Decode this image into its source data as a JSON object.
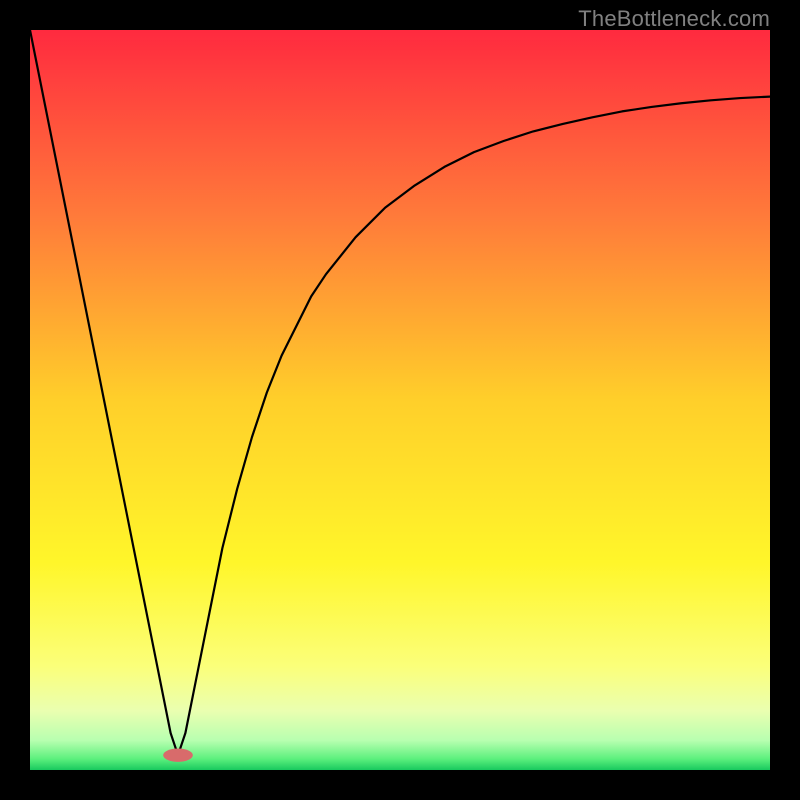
{
  "watermark": "TheBottleneck.com",
  "chart_data": {
    "type": "line",
    "title": "",
    "xlabel": "",
    "ylabel": "",
    "xlim": [
      0,
      100
    ],
    "ylim": [
      0,
      100
    ],
    "series": [
      {
        "name": "curve",
        "x": [
          0,
          2,
          4,
          6,
          8,
          10,
          12,
          14,
          16,
          18,
          19,
          20,
          21,
          22,
          24,
          26,
          28,
          30,
          32,
          34,
          36,
          38,
          40,
          44,
          48,
          52,
          56,
          60,
          64,
          68,
          72,
          76,
          80,
          84,
          88,
          92,
          96,
          100
        ],
        "y": [
          100,
          90,
          80,
          70,
          60,
          50,
          40,
          30,
          20,
          10,
          5,
          2,
          5,
          10,
          20,
          30,
          38,
          45,
          51,
          56,
          60,
          64,
          67,
          72,
          76,
          79,
          81.5,
          83.5,
          85,
          86.3,
          87.3,
          88.2,
          89,
          89.6,
          90.1,
          90.5,
          90.8,
          91
        ]
      }
    ],
    "marker": {
      "x": 20,
      "y": 2,
      "rx": 2.0,
      "ry": 0.9
    },
    "gradient_stops": [
      {
        "offset": 0.0,
        "color": "#ff2a3f"
      },
      {
        "offset": 0.25,
        "color": "#ff7a3a"
      },
      {
        "offset": 0.5,
        "color": "#ffcf2a"
      },
      {
        "offset": 0.72,
        "color": "#fff62a"
      },
      {
        "offset": 0.86,
        "color": "#fbff7a"
      },
      {
        "offset": 0.92,
        "color": "#eaffb0"
      },
      {
        "offset": 0.96,
        "color": "#b8ffb0"
      },
      {
        "offset": 0.985,
        "color": "#5cf07d"
      },
      {
        "offset": 1.0,
        "color": "#18c95e"
      }
    ]
  }
}
